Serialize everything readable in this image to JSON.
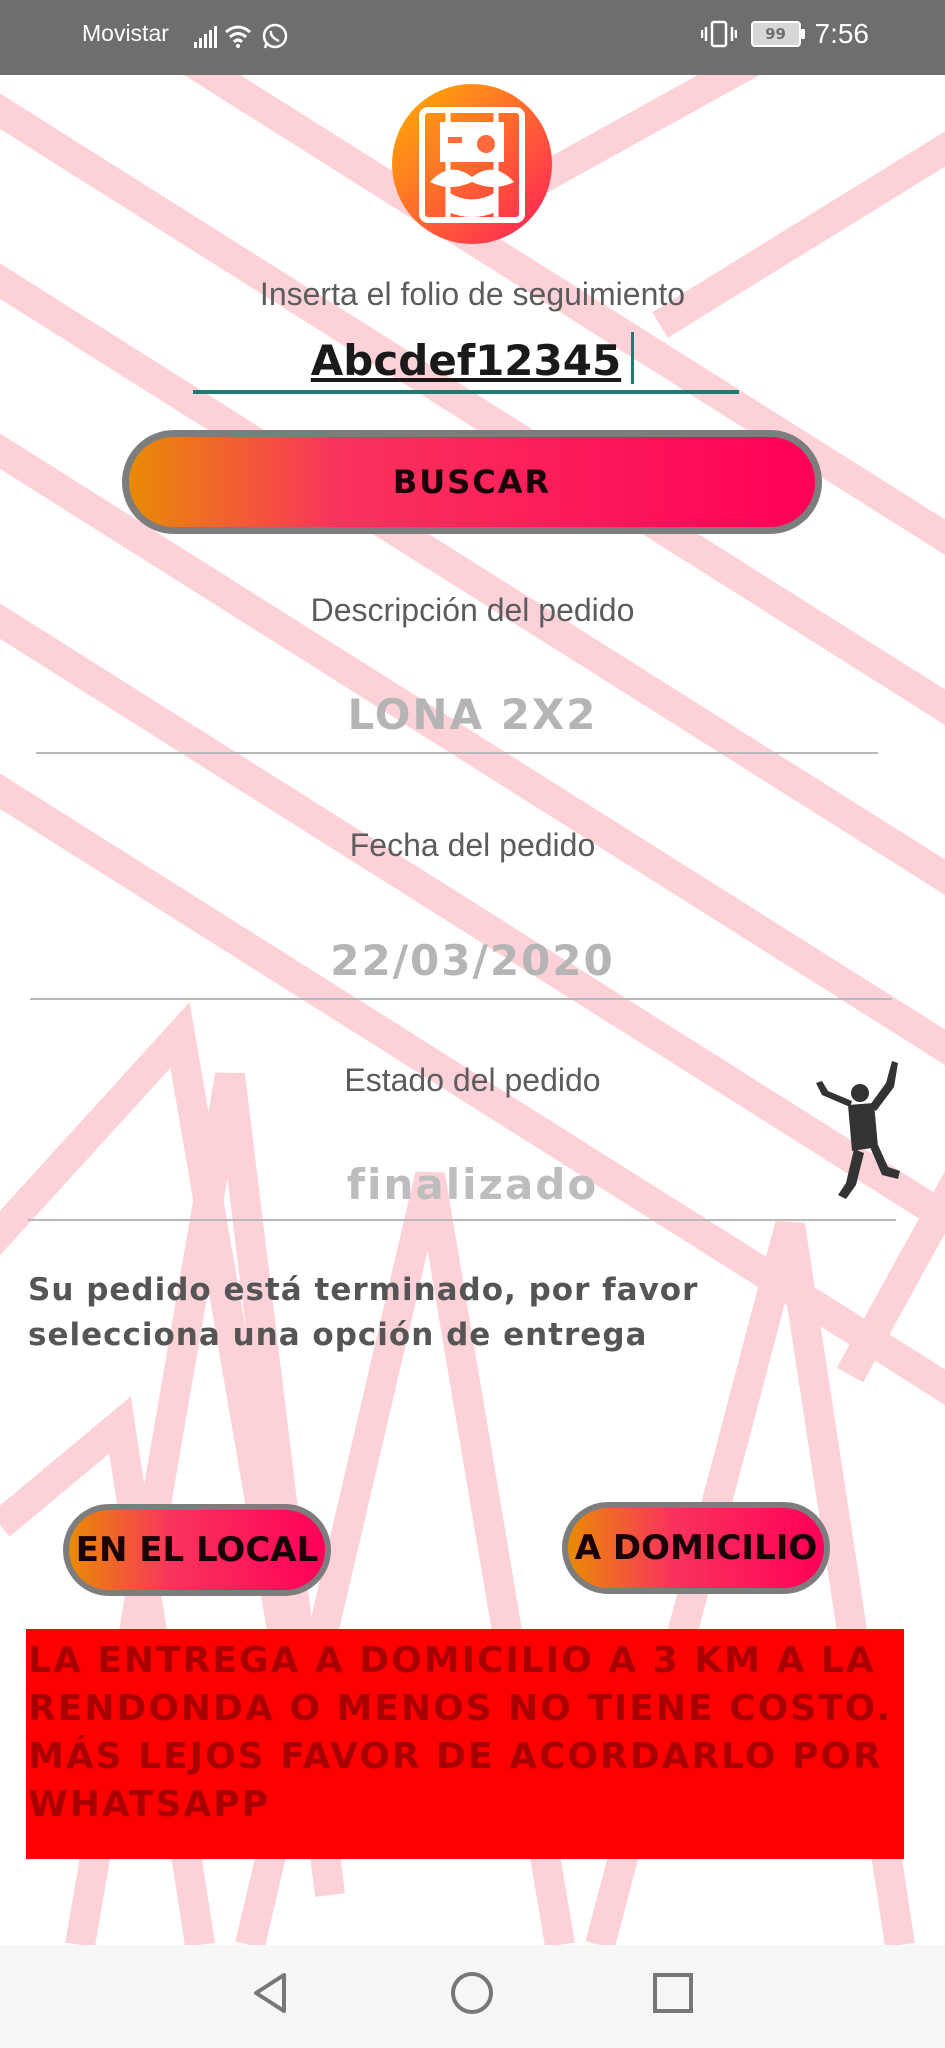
{
  "status_bar": {
    "carrier": "Movistar",
    "battery": "99",
    "time": "7:56"
  },
  "form": {
    "folio_label": "Inserta el folio de seguimiento",
    "folio_value": "Abcdef12345",
    "search_button": "BUSCAR"
  },
  "order": {
    "description_label": "Descripción del pedido",
    "description_value": "LONA 2X2",
    "date_label": "Fecha del pedido",
    "date_value": "22/03/2020",
    "status_label": "Estado del pedido",
    "status_value": "finalizado"
  },
  "delivery": {
    "notice_line1": "Su pedido está terminado, por favor",
    "notice_line2": "selecciona una opción de entrega",
    "local_button": "EN EL LOCAL",
    "home_button": "A DOMICILIO",
    "banner_line1": "LA ENTREGA A DOMICILIO A 3 KM A LA",
    "banner_line2": "RENDONDA O MENOS NO TIENE COSTO.",
    "banner_line3": "MÁS LEJOS FAVOR DE ACORDARLO POR",
    "banner_line4": "WHATSAPP"
  },
  "colors": {
    "accent_orange": "#e98b05",
    "accent_pink": "#ff0058",
    "banner_red": "#ff0000",
    "input_underline": "#1f7a6f"
  },
  "icons": [
    "signal-icon",
    "wifi-icon",
    "whatsapp-icon",
    "vibrate-icon",
    "battery-icon",
    "logo-icon",
    "jumping-man-icon",
    "back-icon",
    "home-icon",
    "recents-icon"
  ]
}
